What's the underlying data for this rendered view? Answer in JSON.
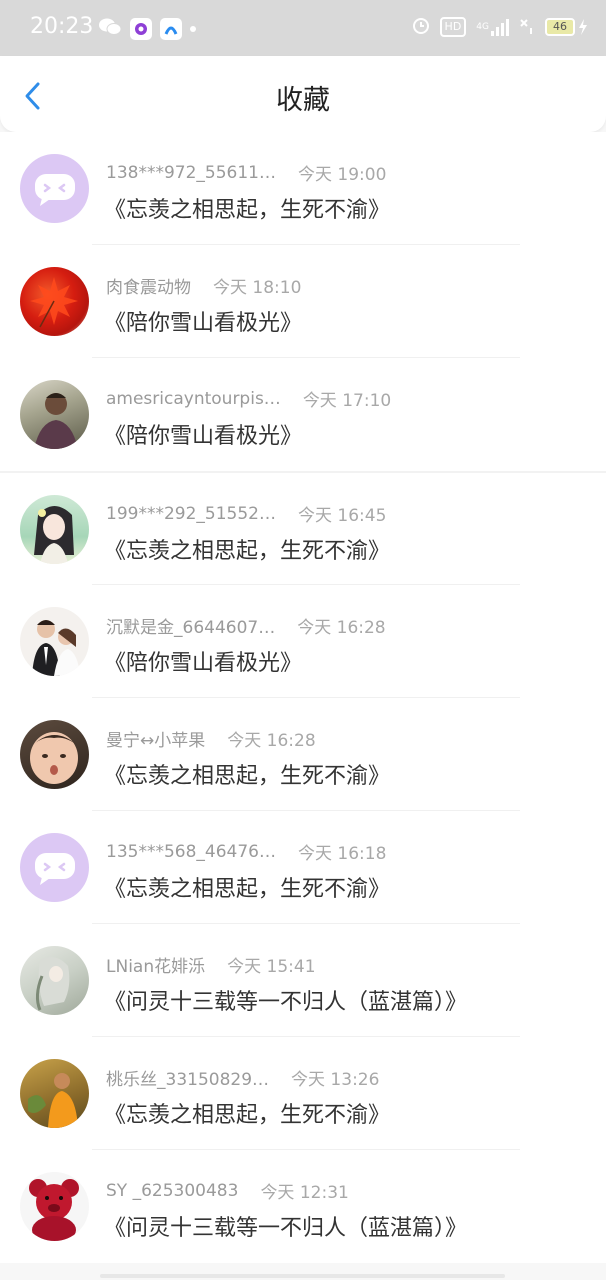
{
  "status_bar": {
    "time": "20:23",
    "network": "4G",
    "battery": "46",
    "hd_label": "HD"
  },
  "header": {
    "title": "收藏"
  },
  "items": [
    {
      "name": "138***972_55611…",
      "time": "今天 19:00",
      "work": "《忘羡之相思起，生死不渝》",
      "avatar": "bubble-icon"
    },
    {
      "name": "肉食震动物",
      "time": "今天 18:10",
      "work": "《陪你雪山看极光》",
      "avatar": "maple-leaf-photo"
    },
    {
      "name": "amesricayntourpis…",
      "time": "今天 17:10",
      "work": "《陪你雪山看极光》",
      "avatar": "man-photo"
    },
    {
      "name": "199***292_51552…",
      "time": "今天 16:45",
      "work": "《忘羡之相思起，生死不渝》",
      "avatar": "anime-girl-photo"
    },
    {
      "name": "沉默是金_6644607…",
      "time": "今天 16:28",
      "work": "《陪你雪山看极光》",
      "avatar": "couple-photo"
    },
    {
      "name": "曼宁↔小苹果",
      "time": "今天 16:28",
      "work": "《忘羡之相思起，生死不渝》",
      "avatar": "baby-photo"
    },
    {
      "name": "135***568_46476…",
      "time": "今天 16:18",
      "work": "《忘羡之相思起，生死不渝》",
      "avatar": "bubble-icon"
    },
    {
      "name": "LNian花婔泺",
      "time": "今天 15:41",
      "work": "《问灵十三载等一不归人（蓝湛篇）》",
      "avatar": "painting-photo"
    },
    {
      "name": "桃乐丝_33150829…",
      "time": "今天 13:26",
      "work": "《忘羡之相思起，生死不渝》",
      "avatar": "monk-photo"
    },
    {
      "name": "SY _625300483",
      "time": "今天 12:31",
      "work": "《问灵十三载等一不归人（蓝湛篇）》",
      "avatar": "teddy-bear-photo"
    }
  ]
}
